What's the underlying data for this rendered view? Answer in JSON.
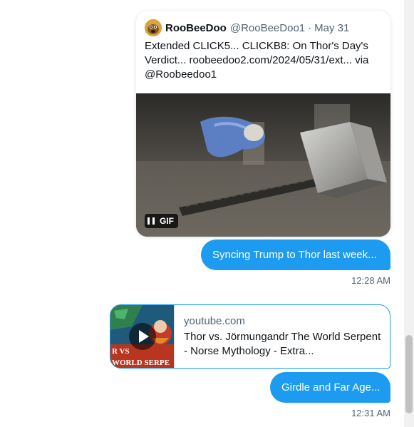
{
  "quoted_tweet": {
    "author_name": "RooBeeDoo",
    "author_handle": "@RooBeeDoo1",
    "separator": "·",
    "date": "May 31",
    "text": "Extended CLICK5... CLICKB8: On Thor's Day's Verdict... roobeedoo2.com/2024/05/31/ext... via @Roobeedoo1",
    "media_badge": "GIF"
  },
  "messages": [
    {
      "text": "Syncing Trump to Thor last week...",
      "time": "12:28 AM"
    },
    {
      "text": "Girdle and Far Age...",
      "time": "12:31 AM"
    }
  ],
  "link_card": {
    "domain": "youtube.com",
    "title": "Thor vs. Jörmungandr The World Serpent - Norse Mythology - Extra...",
    "thumb_text_1": "R VS",
    "thumb_text_2": "WORLD SERPE"
  },
  "colors": {
    "accent": "#1d9bf0",
    "secondary_text": "#536471"
  }
}
